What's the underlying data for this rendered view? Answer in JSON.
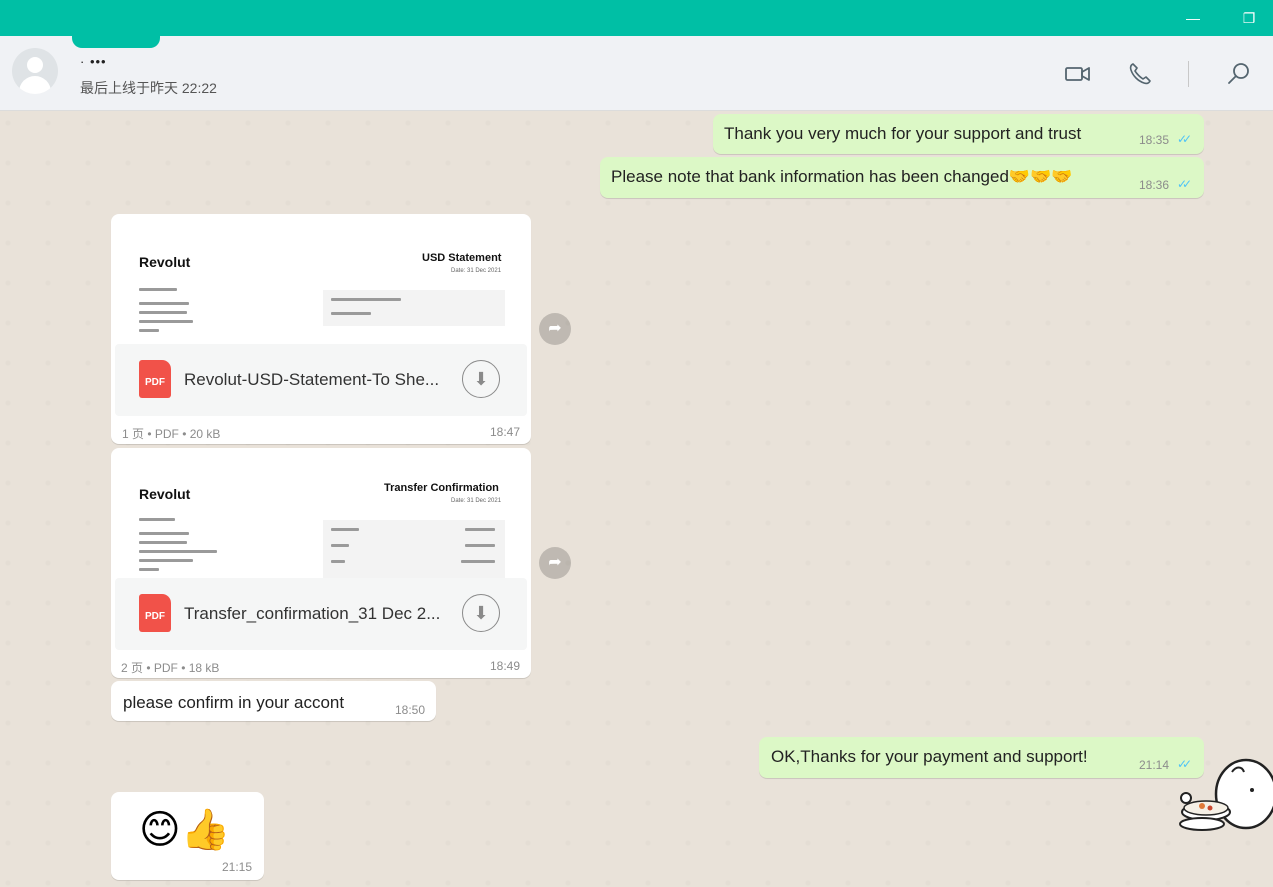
{
  "window": {
    "minimize_icon": "—",
    "restore_icon": "❐"
  },
  "header": {
    "contact_name": "· •••",
    "last_seen": "最后上线于昨天 22:22"
  },
  "messages": [
    {
      "id": "m1",
      "direction": "out",
      "text": "Thank you very much for your support and trust",
      "time": "18:35",
      "ticks": "✓✓"
    },
    {
      "id": "m2",
      "direction": "out",
      "text": "Please note that bank information has been changed🤝🤝🤝",
      "time": "18:36",
      "ticks": "✓✓"
    },
    {
      "id": "m3",
      "direction": "in",
      "type": "document",
      "preview": {
        "brand": "Revolut",
        "title": "USD Statement",
        "date": "Date: 31 Dec 2021"
      },
      "file_type_label": "PDF",
      "file_name": "Revolut-USD-Statement-To She...",
      "meta": "1 页 • PDF • 20 kB",
      "time": "18:47"
    },
    {
      "id": "m4",
      "direction": "in",
      "type": "document",
      "preview": {
        "brand": "Revolut",
        "title": "Transfer Confirmation",
        "date": "Date: 31 Dec 2021"
      },
      "file_type_label": "PDF",
      "file_name": "Transfer_confirmation_31 Dec 2...",
      "meta": "2 页 • PDF • 18 kB",
      "time": "18:49"
    },
    {
      "id": "m5",
      "direction": "in",
      "text": "please confirm in your accont",
      "time": "18:50"
    },
    {
      "id": "m6",
      "direction": "out",
      "text": "OK,Thanks for your payment and support!",
      "time": "21:14",
      "ticks": "✓✓"
    },
    {
      "id": "m7",
      "direction": "in",
      "text": "😊👍",
      "time": "21:15"
    }
  ],
  "colors": {
    "title_bar": "#00bfa5",
    "outgoing_bubble": "#dcf8c6",
    "incoming_bubble": "#ffffff",
    "read_ticks": "#4fc3f7",
    "pdf_icon": "#f15249"
  },
  "icons": {
    "video": "video-call-icon",
    "phone": "voice-call-icon",
    "search": "search-icon",
    "forward": "forward-icon",
    "download": "download-icon"
  }
}
